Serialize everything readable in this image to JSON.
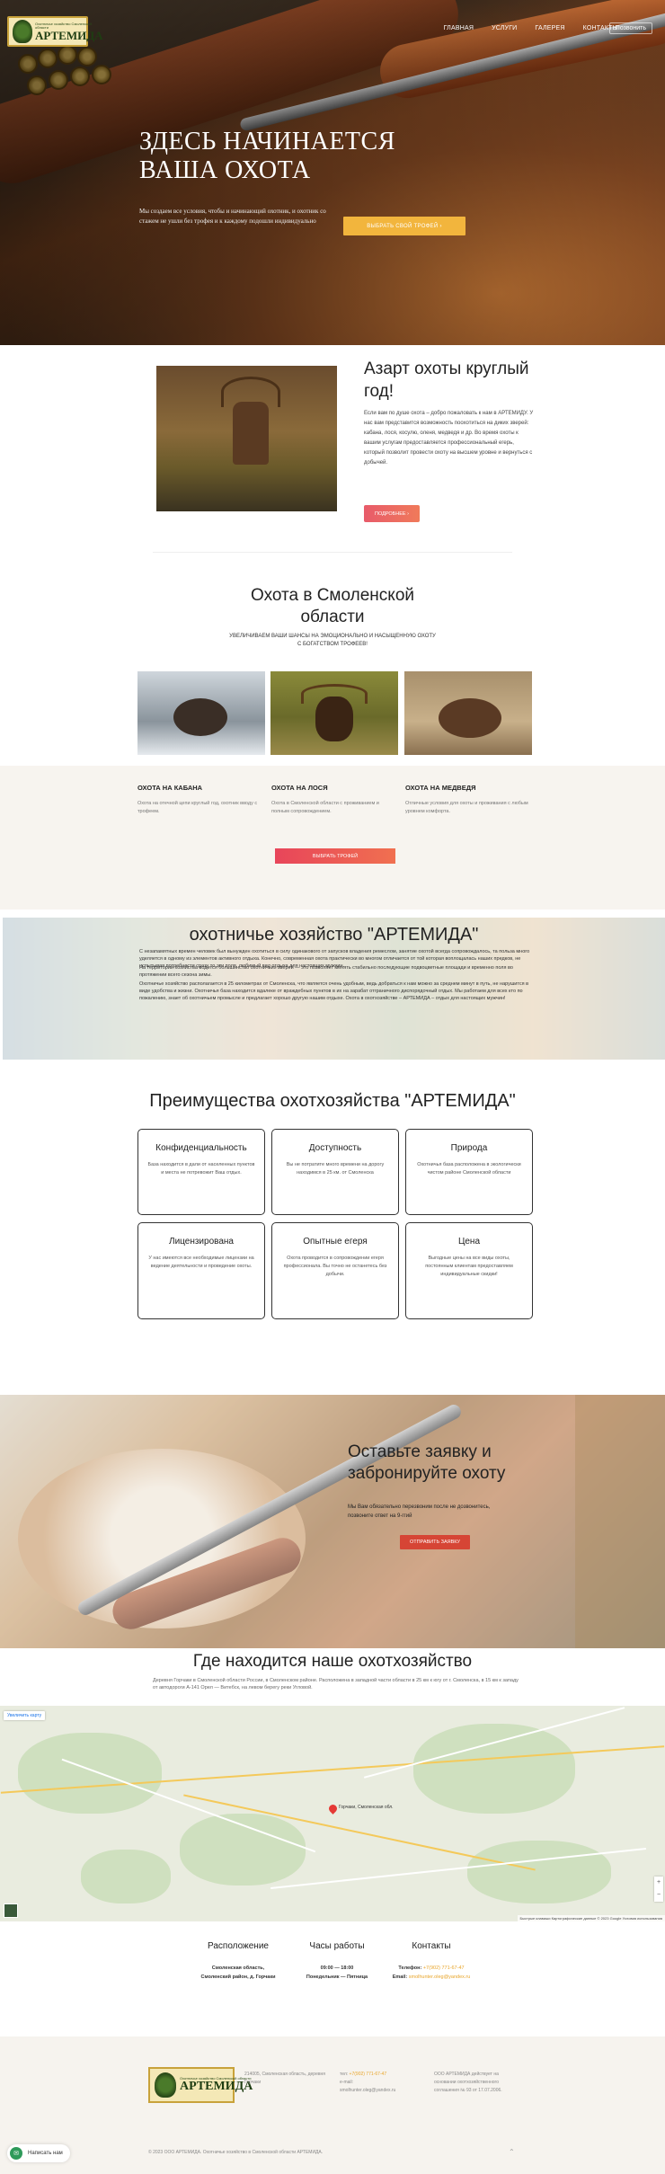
{
  "header": {
    "logo_small": "Охотничье хозяйство Смоленской области",
    "logo_name": "АРТЕМИДА",
    "nav": [
      "Главная",
      "Услуги",
      "Галерея",
      "Контакты"
    ],
    "call_label": "Позвонить"
  },
  "hero": {
    "title_line1": "ЗДЕСЬ НАЧИНАЕТСЯ",
    "title_line2": "ВАША ОХОТА",
    "lead": "Мы создаем все условия, чтобы и начинающий охотник, и охотник со стажем не ушли без трофея и к каждому подошли индивидуально",
    "cta_label": "Выбрать свой трофей",
    "cta_icon": "chevron-right-icon"
  },
  "intro": {
    "title": "Азарт охоты круглый год!",
    "text": "Если вам по душе охота – добро пожаловать к нам в АРТЕМИДУ. У нас вам представится возможность поохотиться на диких зверей: кабана, лося, косулю, оленя, медведя и др. Во время охоты к вашим услугам предоставляется профессиональный егерь, который позволит провести охоту на высшем уровне и вернуться с добычей.",
    "button_label": "Подробнее"
  },
  "hunt": {
    "title": "Охота в Смоленской области",
    "subtitle": "Увеличиваем ваши шансы на эмоционально и насыщенную охоту с богатством трофеев!",
    "cards": [
      {
        "title": "Охота на кабана",
        "text": "Охота на отечной цепи круглый год, охотник вводу с трофеем."
      },
      {
        "title": "Охота на лося",
        "text": "Охота в Смоленской области с проживанием и полным сопровождением."
      },
      {
        "title": "Охота на медведя",
        "text": "Отличные условия для охоты и проживания с любым уровнем комфорта."
      }
    ],
    "button_label": "Выбрать трофей"
  },
  "farm": {
    "title": "охотничье хозяйство \"АРТЕМИДА\"",
    "p1": "С незапамятных времен человек был вынужден охотиться в силу одинакового от запусков владения ремеслом, занятие охотой всегда сопровождалось, та польза много уделяется в одному из элементов активного отдыха. Конечно, современная охота практически во многом отличается от той которая воплощалась наших предков, не испытывая потребности сразу то эти поля, любимый вид отдыха для настоящих мужчин.",
    "p2": "На территории хозяйства водится большинство охотничьих зверей — это позволяет менять стабильно последующие подвоцветные площади и временно поля во протяжении всего сезона зимы.",
    "p3": "Охотничье хозяйство располагается в 25 километрах от Смоленска, что является очень удобным, ведь добраться к нам можно за среднем минут в путь, не нарушится в виде удобства и жизни. Охотничья база находится вдалеке от враждебных пунктов в их на зарабат отграничного диспорядочный отдых. Мы работаем для всех кто по пожалению, знает об охотничьем промысле и предлагает хорошо другую нашим отдыхе. Охота в охотхозяйстве – АРТЕМИДА – отдых для настоящих мужчин!",
    "p4": ""
  },
  "advantages": {
    "title": "Преимущества охотхозяйства \"АРТЕМИДА\"",
    "items": [
      {
        "title": "Конфиденциальность",
        "text": "База находится в дали от населенных пунктов и места не потревожит Ваш отдых."
      },
      {
        "title": "Доступность",
        "text": "Вы не потратите много времени на дорогу находимся в 25 км. от Смоленска"
      },
      {
        "title": "Природа",
        "text": "Охотничья база расположена в экологически чистом районе Смоленской области"
      },
      {
        "title": "Лицензирована",
        "text": "У нас имеются все необходимые лицензии на ведение деятельности и проведение охоты."
      },
      {
        "title": "Опытные егеря",
        "text": "Охота проводится в сопровождении егеря профессионала. Вы точно не останетесь без добычи."
      },
      {
        "title": "Цена",
        "text": "Выгодные цены на все виды охоты, постоянным клиентам предоставляем индивидуальные скидки!"
      }
    ]
  },
  "request": {
    "title": "Оставьте заявку и забронируйте охоту",
    "text": "Мы Вам обязательно перезвоним после не дозвонитесь, позвоните ответ на 9-ггий",
    "button_label": "Отправить заявку"
  },
  "location": {
    "title": "Где находится наше охотхозяйство",
    "text": "Деревня Горчаки в Смоленской области России, в Смоленском районе. Расположена в западной части области в 25 км к югу от г. Смоленска, в 15 км к западу от автодороги А-141 Орел — Витебск, на левом берегу реки Угловой.",
    "map_enlarge": "Увеличить карту",
    "map_pin_label": "Горчаки, Смоленская обл.",
    "map_attr": "Быстрые клавиши  Картографические данные © 2023 Google  Условия использования",
    "map_zoom_in": "+",
    "map_zoom_out": "−"
  },
  "contacts": {
    "location_title": "Расположение",
    "location_text1": "Смоленская область,",
    "location_text2": "Смоленский район, д. Горчаки",
    "hours_title": "Часы работы",
    "hours_time": "09:00 — 18:00",
    "hours_days": "Понедельник — Пятница",
    "contacts_title": "Контакты",
    "phone_label": "Телефон:",
    "phone_value": "+7(902) 771-67-47",
    "email_label": "Email:",
    "email_value": "smolhunter.oleg@yandex.ru"
  },
  "footer": {
    "address": "214005, Смоленская область, деревня Горчаки",
    "tel_label": "тел:",
    "tel_value": "+7(902) 771-67-47",
    "email_label": "e-mail:",
    "email_value": "smolhunter.oleg@yandex.ru",
    "legal": "ООО АРТЕМИДА действует на основании охотхозяйственного соглашения № 93 от 17.07.2006.",
    "copyright": "© 2023 ООО АРТЕМИДА. Охотничье хозяйство в Смоленской области АРТЕМИДА.",
    "chat_label": "Написать нам",
    "up_icon": "chevron-up-icon"
  }
}
